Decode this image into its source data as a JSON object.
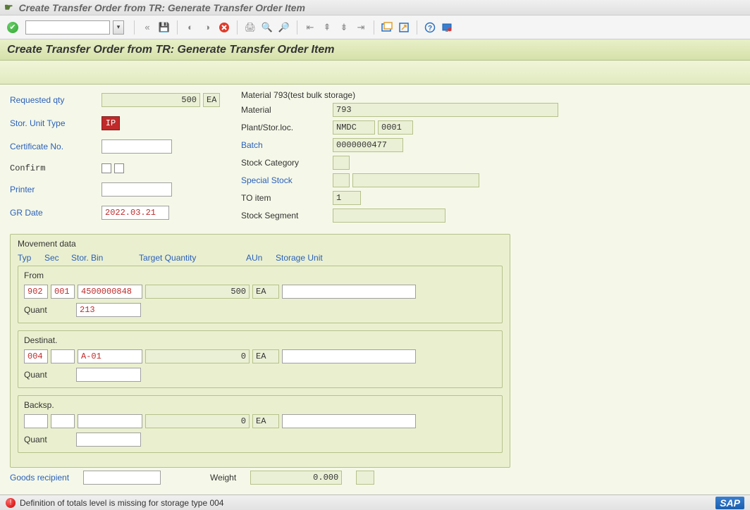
{
  "window": {
    "title": "Create Transfer Order from TR: Generate Transfer Order Item"
  },
  "toolbar": {
    "command_value": "",
    "subtitle": "Create Transfer Order from TR: Generate Transfer Order Item"
  },
  "left": {
    "requested_qty_lbl": "Requested qty",
    "requested_qty": "500",
    "requested_qty_uom": "EA",
    "stor_unit_type_lbl": "Stor. Unit Type",
    "stor_unit_type": "IP",
    "certificate_no_lbl": "Certificate No.",
    "certificate_no": "",
    "confirm_lbl": "Confirm",
    "printer_lbl": "Printer",
    "printer": "",
    "gr_date_lbl": "GR Date",
    "gr_date": "2022.03.21"
  },
  "right": {
    "mat_header": "Material 793(test bulk storage)",
    "material_lbl": "Material",
    "material": "793",
    "plant_loc_lbl": "Plant/Stor.loc.",
    "plant": "NMDC",
    "sloc": "0001",
    "batch_lbl": "Batch",
    "batch": "0000000477",
    "stock_cat_lbl": "Stock Category",
    "stock_cat": "",
    "special_stock_lbl": "Special Stock",
    "special_stock_ind": "",
    "special_stock_ref": "",
    "to_item_lbl": "TO item",
    "to_item": "1",
    "stock_segment_lbl": "Stock Segment",
    "stock_segment": ""
  },
  "movement": {
    "group_title": "Movement data",
    "headers": {
      "typ": "Typ",
      "sec": "Sec",
      "bin": "Stor. Bin",
      "target_qty": "Target Quantity",
      "aun": "AUn",
      "su": "Storage Unit"
    },
    "from": {
      "title": "From",
      "typ": "902",
      "sec": "001",
      "bin": "4500000848",
      "qty": "500",
      "aun": "EA",
      "su": "",
      "quant_lbl": "Quant",
      "quant": "213"
    },
    "dest": {
      "title": "Destinat.",
      "typ": "004",
      "sec": "",
      "bin": "A-01",
      "qty": "0",
      "aun": "EA",
      "su": "",
      "quant_lbl": "Quant",
      "quant": ""
    },
    "back": {
      "title": "Backsp.",
      "typ": "",
      "sec": "",
      "bin": "",
      "qty": "0",
      "aun": "EA",
      "su": "",
      "quant_lbl": "Quant",
      "quant": ""
    }
  },
  "footer": {
    "goods_recipient_lbl": "Goods recipient",
    "goods_recipient": "",
    "weight_lbl": "Weight",
    "weight": "0.000",
    "weight_uom": ""
  },
  "status": {
    "message": "Definition of totals level is missing for storage type 004",
    "logo": "SAP"
  }
}
